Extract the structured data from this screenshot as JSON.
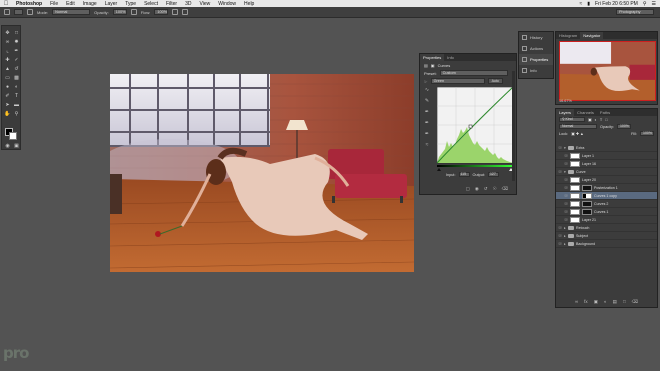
{
  "menubar": {
    "app": "Photoshop",
    "items": [
      "File",
      "Edit",
      "Image",
      "Layer",
      "Type",
      "Select",
      "Filter",
      "3D",
      "View",
      "Window",
      "Help"
    ],
    "clock": "Fri Feb 20  6:50 PM"
  },
  "options": {
    "mode_label": "Mode:",
    "mode_value": "Normal",
    "opacity_label": "Opacity:",
    "opacity_value": "100%",
    "flow_label": "Flow:",
    "flow_value": "100%",
    "workspace": "Photography"
  },
  "dock": {
    "items": [
      "History",
      "Actions",
      "Properties",
      "Info"
    ]
  },
  "navigator": {
    "tabs": [
      "Histogram",
      "Navigator"
    ],
    "zoom": "16.67%"
  },
  "properties": {
    "tabs": [
      "Properties",
      "Info"
    ],
    "title": "Curves",
    "preset_label": "Preset:",
    "preset_value": "Custom",
    "channel_value": "Green",
    "auto_label": "Auto",
    "input_label": "Input:",
    "input_value": "115",
    "output_label": "Output:",
    "output_value": "127"
  },
  "layers": {
    "tabs": [
      "Layers",
      "Channels",
      "Paths"
    ],
    "kind_label": "Kind",
    "blend_value": "Normal",
    "opacity_label": "Opacity:",
    "opacity_value": "100%",
    "lock_label": "Lock:",
    "fill_label": "Fill:",
    "fill_value": "100%",
    "rows": [
      {
        "name": "Extra",
        "type": "folder"
      },
      {
        "name": "Layer 1",
        "type": "layer"
      },
      {
        "name": "Layer 16",
        "type": "layer"
      },
      {
        "name": "Curve",
        "type": "folder"
      },
      {
        "name": "Layer 20",
        "type": "layer"
      },
      {
        "name": "Posterization 1",
        "type": "adj"
      },
      {
        "name": "Curves 1 copy",
        "type": "adj"
      },
      {
        "name": "Curves 2",
        "type": "adj"
      },
      {
        "name": "Curves 1",
        "type": "adj"
      },
      {
        "name": "Layer 21",
        "type": "layer"
      },
      {
        "name": "Retouch",
        "type": "folder"
      },
      {
        "name": "Subject",
        "type": "folder"
      },
      {
        "name": "Background",
        "type": "folder"
      }
    ]
  },
  "colors": {
    "panel": "#3c3c3c",
    "workspace": "#535353",
    "selection": "#5a6a80",
    "histogram": "#9bd46b"
  },
  "watermark": "pro"
}
